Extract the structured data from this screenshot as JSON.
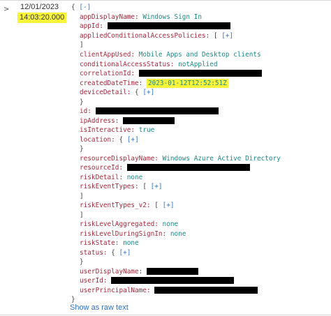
{
  "entry": {
    "caret": ">",
    "date": "12/01/2023",
    "time": "14:03:20.000"
  },
  "json": {
    "root_open": "{",
    "root_toggle": "[-]",
    "root_close": "}",
    "fields": {
      "appDisplayName": {
        "key": "appDisplayName:",
        "value": "Windows Sign In"
      },
      "appId": {
        "key": "appId:"
      },
      "appliedConditionalAccessPolicies": {
        "key": "appliedConditionalAccessPolicies:",
        "open": "[",
        "toggle": "[+]",
        "close": "]"
      },
      "clientAppUsed": {
        "key": "clientAppUsed:",
        "value": "Mobile Apps and Desktop clients"
      },
      "conditionalAccessStatus": {
        "key": "conditionalAccessStatus:",
        "value": "notApplied"
      },
      "correlationId": {
        "key": "correlationId:"
      },
      "createdDateTime": {
        "key": "createdDateTime:",
        "value": "2023-01-12T12:52:51Z"
      },
      "deviceDetail": {
        "key": "deviceDetail:",
        "open": "{",
        "toggle": "[+]",
        "close": "}"
      },
      "id": {
        "key": "id:"
      },
      "ipAddress": {
        "key": "ipAddress:"
      },
      "isInteractive": {
        "key": "isInteractive:",
        "value": "true"
      },
      "location": {
        "key": "location:",
        "open": "{",
        "toggle": "[+]",
        "close": "}"
      },
      "resourceDisplayName": {
        "key": "resourceDisplayName:",
        "value": "Windows Azure Active Directory"
      },
      "resourceId": {
        "key": "resourceId:"
      },
      "riskDetail": {
        "key": "riskDetail:",
        "value": "none"
      },
      "riskEventTypes": {
        "key": "riskEventTypes:",
        "open": "[",
        "toggle": "[+]",
        "close": "]"
      },
      "riskEventTypes_v2": {
        "key": "riskEventTypes_v2:",
        "open": "[",
        "toggle": "[+]",
        "close": "]"
      },
      "riskLevelAggregated": {
        "key": "riskLevelAggregated:",
        "value": "none"
      },
      "riskLevelDuringSignIn": {
        "key": "riskLevelDuringSignIn:",
        "value": "none"
      },
      "riskState": {
        "key": "riskState:",
        "value": "none"
      },
      "status": {
        "key": "status:",
        "open": "{",
        "toggle": "[+]",
        "close": "}"
      },
      "userDisplayName": {
        "key": "userDisplayName:"
      },
      "userId": {
        "key": "userId:"
      },
      "userPrincipalName": {
        "key": "userPrincipalName:"
      }
    }
  },
  "footer": {
    "raw_link": "Show as raw text"
  },
  "colors": {
    "key": "#a8283c",
    "value": "#1a8a8a",
    "link": "#2f72c4",
    "highlight": "#fbf53a",
    "redaction": "#000000"
  }
}
